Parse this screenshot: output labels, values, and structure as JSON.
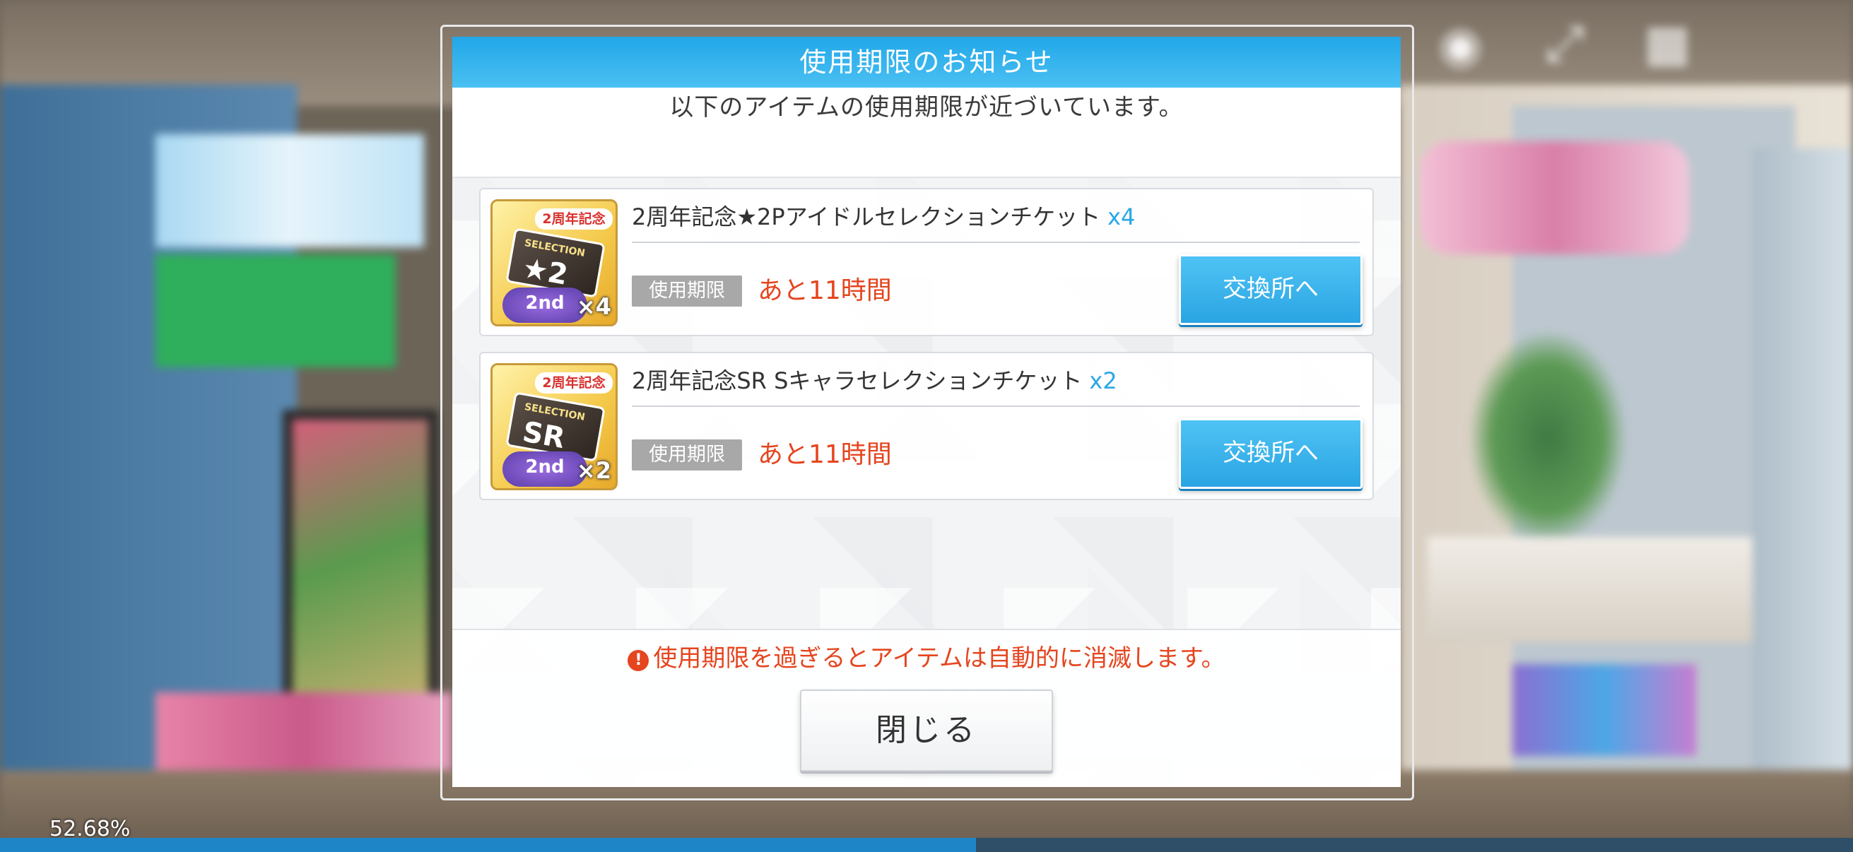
{
  "dialog": {
    "title": "使用期限のお知らせ",
    "subtitle": "以下のアイテムの使用期限が近づいています。",
    "items": [
      {
        "name": "2周年記念★2Pアイドルセレクションチケット",
        "quantity": "x4",
        "icon": {
          "ribbon": "2周年記念",
          "card_small": "SELECTION",
          "card_big": "★2",
          "badge": "2nd",
          "quantity": "×4"
        },
        "expiry_label": "使用期限",
        "expiry_value": "あと11時間",
        "button_label": "交換所へ"
      },
      {
        "name": "2周年記念SR Sキャラセレクションチケット",
        "quantity": "x2",
        "icon": {
          "ribbon": "2周年記念",
          "card_small": "SELECTION",
          "card_big": "SR",
          "badge": "2nd",
          "quantity": "×2"
        },
        "expiry_label": "使用期限",
        "expiry_value": "あと11時間",
        "button_label": "交換所へ"
      }
    ],
    "warning_icon": "!",
    "warning": "使用期限を過ぎるとアイテムは自動的に消滅します。",
    "close_label": "閉じる"
  },
  "loading": {
    "percent_text": "52.68%",
    "progress": 0.5268
  },
  "hud": {
    "icons": [
      "camera-icon",
      "fullscreen-icon",
      "grid-menu-icon"
    ]
  },
  "colors": {
    "header_blue": "#22a7e8",
    "button_blue": "#2aa4e3",
    "warning_red": "#e5451f",
    "quantity_blue": "#2aa7e6",
    "expiry_tag_gray": "#a8a8a8"
  }
}
